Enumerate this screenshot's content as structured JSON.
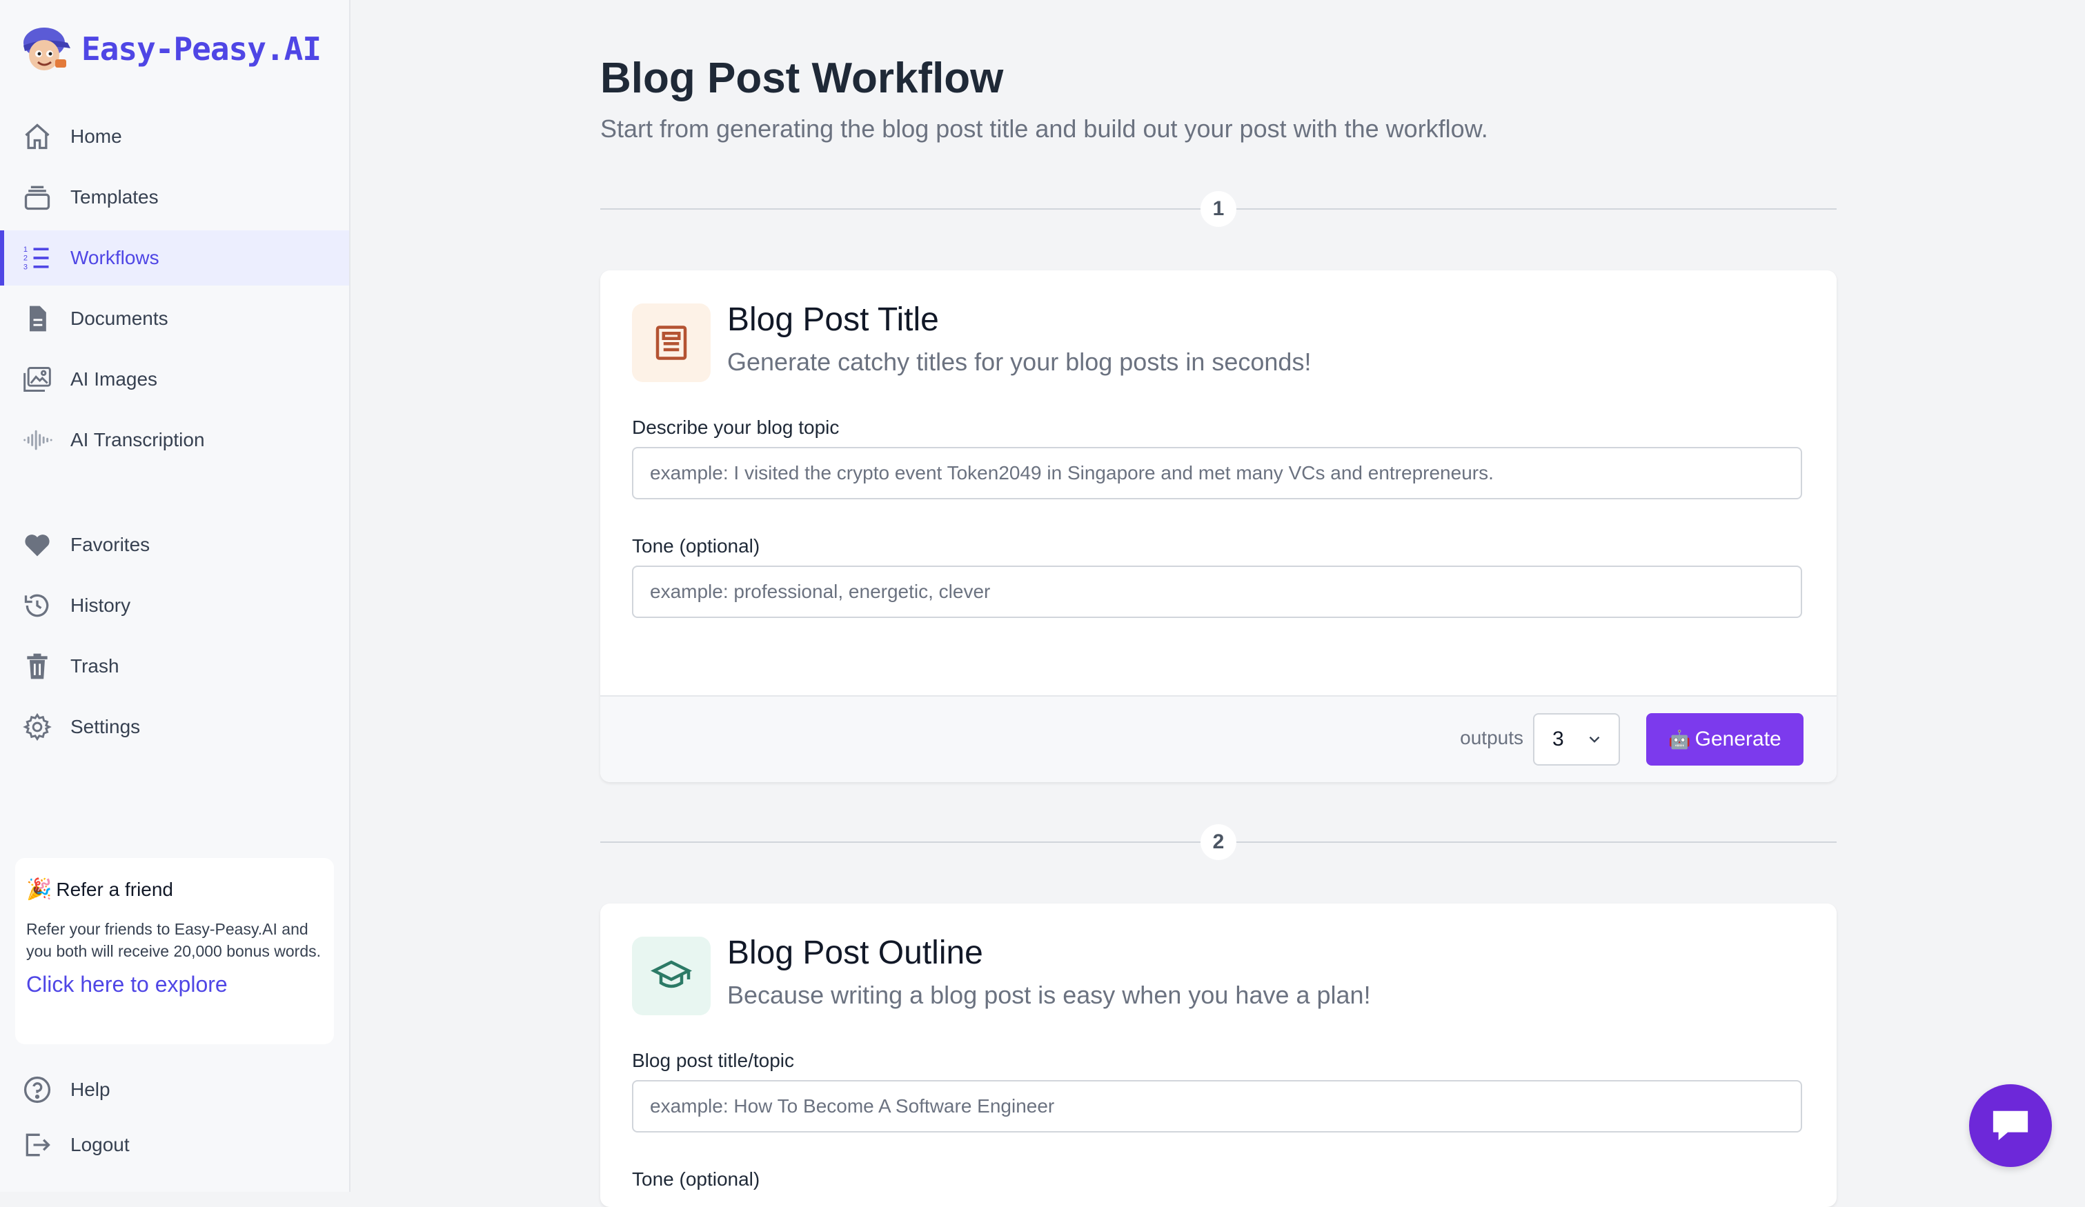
{
  "brand": {
    "name": "Easy-Peasy.AI"
  },
  "sidebar": {
    "items": [
      {
        "label": "Home",
        "icon": "home-icon"
      },
      {
        "label": "Templates",
        "icon": "templates-icon"
      },
      {
        "label": "Workflows",
        "icon": "workflows-icon",
        "active": true
      },
      {
        "label": "Documents",
        "icon": "document-icon"
      },
      {
        "label": "AI Images",
        "icon": "images-icon"
      },
      {
        "label": "AI Transcription",
        "icon": "waveform-icon"
      },
      {
        "label": "Favorites",
        "icon": "heart-icon"
      },
      {
        "label": "History",
        "icon": "history-icon"
      },
      {
        "label": "Trash",
        "icon": "trash-icon"
      },
      {
        "label": "Settings",
        "icon": "gear-icon"
      }
    ],
    "refer": {
      "emoji": "🎉",
      "title": "Refer a friend",
      "body": "Refer your friends to Easy-Peasy.AI and you both will receive 20,000 bonus words.",
      "link": "Click here to explore"
    },
    "bottom": [
      {
        "label": "Help",
        "icon": "help-icon"
      },
      {
        "label": "Logout",
        "icon": "logout-icon"
      }
    ]
  },
  "page": {
    "title": "Blog Post Workflow",
    "subtitle": "Start from generating the blog post title and build out your post with the workflow."
  },
  "steps": [
    {
      "number": "1",
      "title": "Blog Post Title",
      "description": "Generate catchy titles for your blog posts in seconds!",
      "fields": [
        {
          "label": "Describe your blog topic",
          "placeholder": "example: I visited the crypto event Token2049 in Singapore and met many VCs and entrepreneurs.",
          "value": ""
        },
        {
          "label": "Tone (optional)",
          "placeholder": "example: professional, energetic, clever",
          "value": ""
        }
      ],
      "outputs_label": "outputs",
      "outputs_value": "3",
      "generate_label": "Generate",
      "generate_icon": "🤖"
    },
    {
      "number": "2",
      "title": "Blog Post Outline",
      "description": "Because writing a blog post is easy when you have a plan!",
      "fields": [
        {
          "label": "Blog post title/topic",
          "placeholder": "example: How To Become A Software Engineer",
          "value": ""
        },
        {
          "label": "Tone (optional)"
        }
      ]
    }
  ],
  "colors": {
    "accent": "#4f46e5",
    "generate": "#7c3aed",
    "chat": "#6d28d9",
    "step1_icon_bg": "#fdf2e7",
    "step1_icon": "#b45332",
    "step2_icon_bg": "#e8f6f1",
    "step2_icon": "#2c7a66"
  }
}
